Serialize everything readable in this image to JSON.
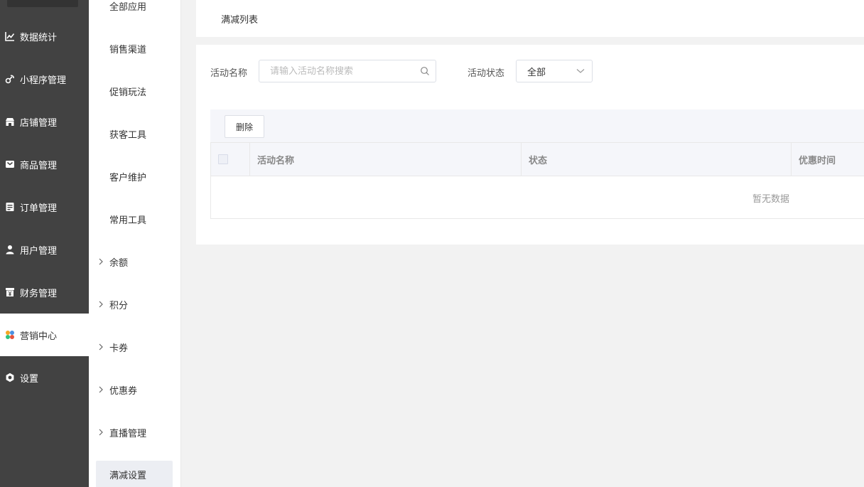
{
  "nav1": {
    "items": [
      {
        "label": "数据统计",
        "icon": "chart-line-icon"
      },
      {
        "label": "小程序管理",
        "icon": "link-icon"
      },
      {
        "label": "店铺管理",
        "icon": "store-icon"
      },
      {
        "label": "商品管理",
        "icon": "box-icon"
      },
      {
        "label": "订单管理",
        "icon": "order-icon"
      },
      {
        "label": "用户管理",
        "icon": "user-icon"
      },
      {
        "label": "财务管理",
        "icon": "yen-icon"
      },
      {
        "label": "营销中心",
        "icon": "marketing-icon",
        "active": true
      },
      {
        "label": "设置",
        "icon": "gear-icon"
      }
    ]
  },
  "nav2": {
    "items": [
      {
        "label": "全部应用"
      },
      {
        "label": "销售渠道"
      },
      {
        "label": "促销玩法"
      },
      {
        "label": "获客工具"
      },
      {
        "label": "客户维护"
      },
      {
        "label": "常用工具"
      },
      {
        "label": "余额"
      },
      {
        "label": "积分"
      },
      {
        "label": "卡券"
      },
      {
        "label": "优惠券"
      },
      {
        "label": "直播管理"
      },
      {
        "label": "满减设置"
      }
    ]
  },
  "tabbar": {
    "active_tab": "满减列表"
  },
  "filters": {
    "name_label": "活动名称",
    "name_placeholder": "请输入活动名称搜索",
    "name_value": "",
    "status_label": "活动状态",
    "status_value": "全部"
  },
  "toolbar": {
    "delete_label": "删除"
  },
  "table": {
    "columns": [
      "活动名称",
      "状态",
      "优惠时间"
    ],
    "rows": [],
    "empty_text": "暂无数据"
  },
  "colors": {
    "sidebar_bg": "#424242",
    "accent": "#eceef3"
  }
}
